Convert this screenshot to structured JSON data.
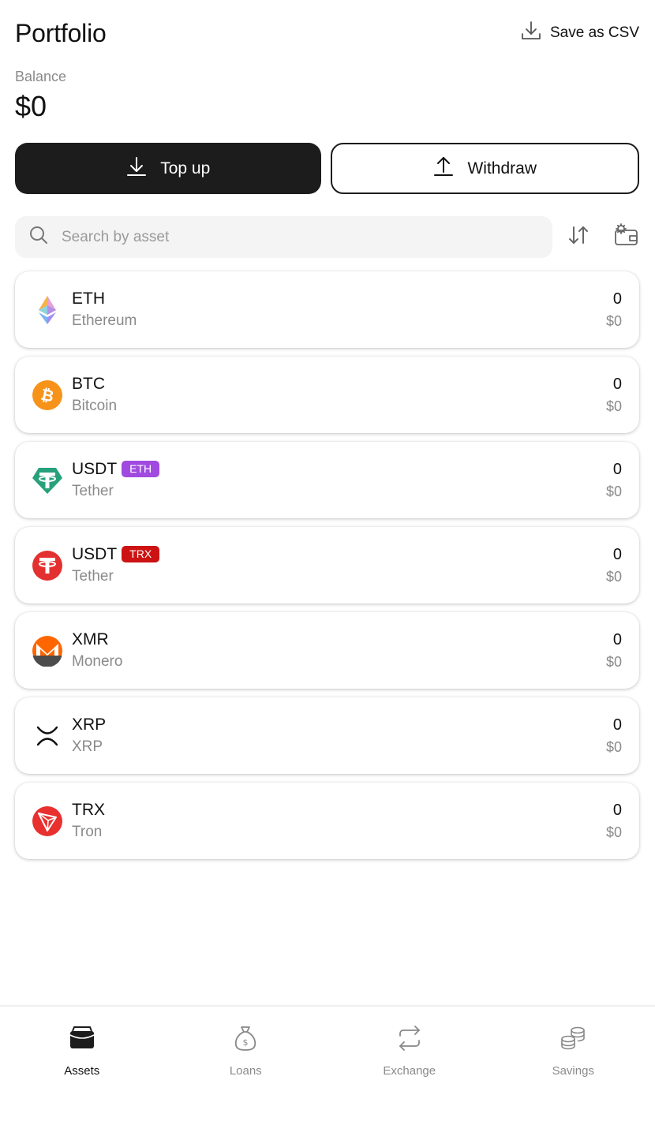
{
  "header": {
    "title": "Portfolio",
    "csv_label": "Save as CSV",
    "csv_icon": "download-tray-icon"
  },
  "balance": {
    "label": "Balance",
    "value": "$0"
  },
  "actions": {
    "top_up_label": "Top up",
    "top_up_icon": "download-arrow-icon",
    "withdraw_label": "Withdraw",
    "withdraw_icon": "upload-arrow-icon"
  },
  "search": {
    "placeholder": "Search by asset",
    "value": "",
    "icon": "search-icon",
    "sort_icon": "sort-arrows-icon",
    "settings_icon": "wallet-settings-icon"
  },
  "assets": [
    {
      "symbol": "ETH",
      "name": "Ethereum",
      "badge": "",
      "badge_color": "",
      "amount": "0",
      "usd": "$0",
      "icon": "ethereum-icon"
    },
    {
      "symbol": "BTC",
      "name": "Bitcoin",
      "badge": "",
      "badge_color": "",
      "amount": "0",
      "usd": "$0",
      "icon": "bitcoin-icon"
    },
    {
      "symbol": "USDT",
      "name": "Tether",
      "badge": "ETH",
      "badge_color": "#a04ae0",
      "amount": "0",
      "usd": "$0",
      "icon": "tether-green-icon"
    },
    {
      "symbol": "USDT",
      "name": "Tether",
      "badge": "TRX",
      "badge_color": "#cc1212",
      "amount": "0",
      "usd": "$0",
      "icon": "tether-red-icon"
    },
    {
      "symbol": "XMR",
      "name": "Monero",
      "badge": "",
      "badge_color": "",
      "amount": "0",
      "usd": "$0",
      "icon": "monero-icon"
    },
    {
      "symbol": "XRP",
      "name": "XRP",
      "badge": "",
      "badge_color": "",
      "amount": "0",
      "usd": "$0",
      "icon": "xrp-icon"
    },
    {
      "symbol": "TRX",
      "name": "Tron",
      "badge": "",
      "badge_color": "",
      "amount": "0",
      "usd": "$0",
      "icon": "tron-icon"
    }
  ],
  "nav": [
    {
      "label": "Assets",
      "icon": "wallet-icon",
      "active": true
    },
    {
      "label": "Loans",
      "icon": "money-bag-icon",
      "active": false
    },
    {
      "label": "Exchange",
      "icon": "exchange-icon",
      "active": false
    },
    {
      "label": "Savings",
      "icon": "coin-stack-icon",
      "active": false
    }
  ],
  "colors": {
    "primary_dark": "#1c1c1c",
    "muted_text": "#8a8a8a",
    "search_bg": "#f4f4f4"
  }
}
